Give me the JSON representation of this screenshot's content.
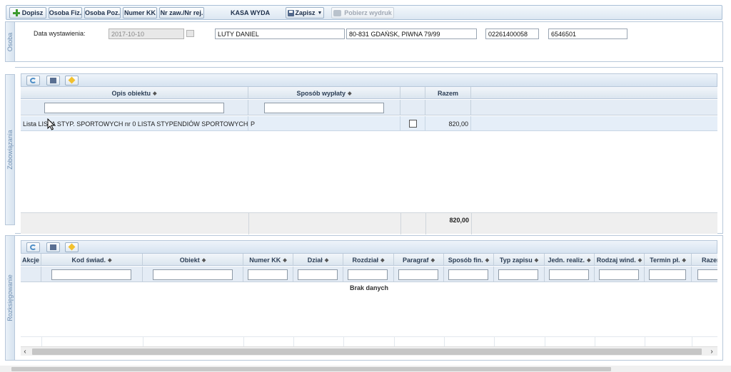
{
  "toolbar": {
    "dopisz": "Dopisz",
    "osoba_fiz": "Osoba Fiz.",
    "osoba_poz": "Osoba Poz.",
    "numer_kk": "Numer KK",
    "nr_zaw": "Nr zaw./Nr rej.",
    "title": "KASA WYDA",
    "zapisz": "Zapisz",
    "pobierz": "Pobierz wydruk"
  },
  "osoba": {
    "tab": "Osoba",
    "date_label": "Data wystawienia:",
    "date_value": "2017-10-10",
    "name": "LUTY DANIEL",
    "address": "80-831 GDAŃSK, PIWNA 79/99",
    "field3": "02261400058",
    "field4": "6546501"
  },
  "zobowiazania": {
    "tab": "Zobowiązania",
    "columns": [
      "Opis obiektu",
      "Sposób wypłaty",
      "",
      "Razem"
    ],
    "rows": [
      {
        "opis": "Lista LISTA STYP. SPORTOWYCH nr 0 LISTA STYPENDIÓW SPORTOWYCH(...)",
        "sposob": "P",
        "razem": "820,00"
      }
    ],
    "total": "820,00"
  },
  "rozksiegowanie": {
    "tab": "Rozksięgowanie",
    "columns": [
      "Akcje",
      "Kod świad.",
      "Obiekt",
      "Numer KK",
      "Dział",
      "Rozdział",
      "Paragraf",
      "Sposób fin.",
      "Typ zapisu",
      "Jedn. realiz.",
      "Rodzaj wind.",
      "Termin pł.",
      "Razem"
    ],
    "empty": "Brak danych"
  },
  "colors": {
    "accent": "#d6e3f0",
    "border": "#b8c8da"
  }
}
